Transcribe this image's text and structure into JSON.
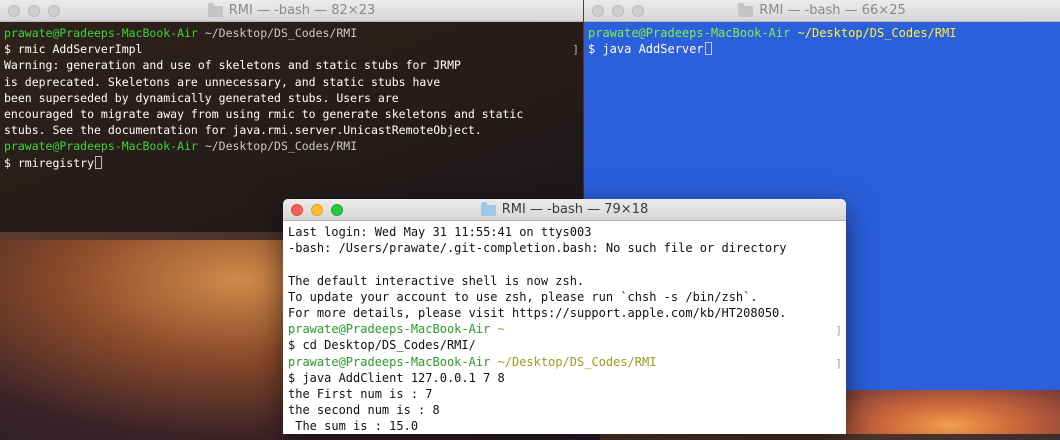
{
  "windows": {
    "rmi_registry": {
      "title": "RMI — -bash — 82×23",
      "prompt": "prawate@Pradeeps-MacBook-Air",
      "path": "~/Desktop/DS_Codes/RMI",
      "cmd1": "$ rmic AddServerImpl",
      "warning": [
        "Warning: generation and use of skeletons and static stubs for JRMP",
        "is deprecated. Skeletons are unnecessary, and static stubs have",
        "been superseded by dynamically generated stubs. Users are",
        "encouraged to migrate away from using rmic to generate skeletons and static",
        "stubs. See the documentation for java.rmi.server.UnicastRemoteObject."
      ],
      "cmd2": "$ rmiregistry"
    },
    "server": {
      "title": "RMI — -bash — 66×25",
      "prompt": "prawate@Pradeeps-MacBook-Air",
      "path": "~/Desktop/DS_Codes/RMI",
      "cmd": "$ java AddServer"
    },
    "client": {
      "title": "RMI — -bash — 79×18",
      "last_login": "Last login: Wed May 31 11:55:41 on ttys003",
      "bash_error": "-bash: /Users/prawate/.git-completion.bash: No such file or directory",
      "zsh_notice": [
        "The default interactive shell is now zsh.",
        "To update your account to use zsh, please run `chsh -s /bin/zsh`.",
        "For more details, please visit https://support.apple.com/kb/HT208050."
      ],
      "prompt": "prawate@Pradeeps-MacBook-Air",
      "home": "~",
      "cmd_cd": "$ cd Desktop/DS_Codes/RMI/",
      "path": "~/Desktop/DS_Codes/RMI",
      "cmd_run": "$ java AddClient 127.0.0.1 7 8",
      "output": [
        "the First num is : 7",
        "the second num is : 8",
        " The sum is : 15.0"
      ]
    }
  }
}
